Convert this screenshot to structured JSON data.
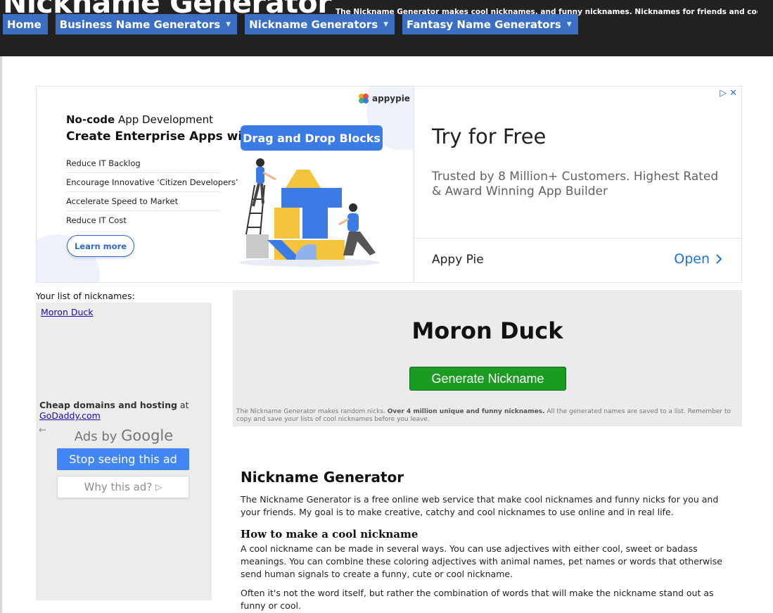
{
  "header": {
    "site_title": "Nickname Generator",
    "tagline": "The Nickname Generator makes cool nicknames, and funny nicknames. Nicknames for friends and cool",
    "nav": [
      {
        "label": "Home",
        "dropdown": false
      },
      {
        "label": "Business Name Generators",
        "dropdown": true
      },
      {
        "label": "Nickname Generators",
        "dropdown": true
      },
      {
        "label": "Fantasy Name Generators",
        "dropdown": true
      }
    ]
  },
  "ad_banner": {
    "logo": "appypie",
    "headline_bold": "No-code",
    "headline_rest": " App Development",
    "headline_2": "Create Enterprise Apps with",
    "pill": "Drag and Drop Blocks",
    "bullets": [
      "Reduce IT Backlog",
      "Encourage Innovative ‘Citizen Developers’",
      "Accelerate Speed to Market",
      "Reduce IT Cost"
    ],
    "learn_more": "Learn more",
    "try": "Try for Free",
    "trusted": "Trusted by 8 Million+ Customers. Highest Rated & Award Winning App Builder",
    "brand": "Appy Pie",
    "open": "Open",
    "accent": "#3a7be6"
  },
  "sidebar": {
    "list_title": "Your list of nicknames:",
    "nicknames": [
      "Moron Duck"
    ],
    "hosting_bold": "Cheap domains and hosting",
    "hosting_at": " at",
    "hosting_link": "GoDaddy.com "
  },
  "google_ad": {
    "ads_by": "Ads by ",
    "google": "Google",
    "stop": "Stop seeing this ad",
    "why": "Why this ad?"
  },
  "generator": {
    "current_name": "Moron Duck",
    "button": "Generate Nickname",
    "desc_pre": "The Nickname Generator makes random nicks. ",
    "desc_bold": "Over 4 million unique and funny nicknames.",
    "desc_post": " All the generated names are saved to a list. Remember to copy and save your lists of cool nicknames before you leave.",
    "button_color": "#1c9b23"
  },
  "article": {
    "title": "Nickname Generator",
    "intro": "The Nickname Generator is a free online web service that make cool nicknames and funny nicks for you and your friends. My goal is to make creative, catchy and cool nicknames to use online and in real life.",
    "h2": "How to make a cool nickname",
    "p1": "A cool nickname can be made in several ways. You can use adjectives with either cool, sweet or badass meanings. You can combine these coloring adjectives with animal names, pet names or words that otherwise send human signals to create a funny, cute or cool nickname.",
    "p2": "Often it's not the word itself, but rather the combination of words that will make the nickname stand out as funny or cool."
  }
}
